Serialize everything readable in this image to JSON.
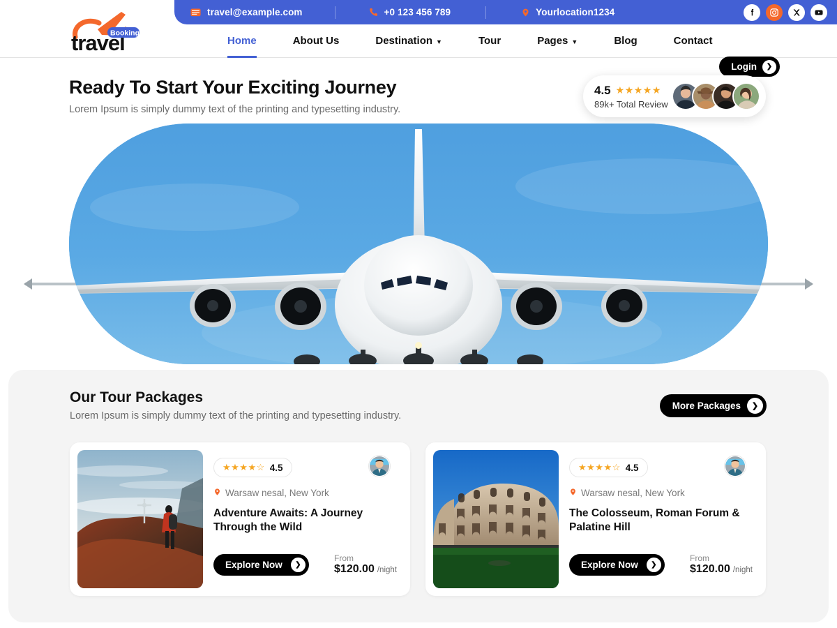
{
  "topbar": {
    "email": "travel@example.com",
    "phone": "+0 123 456 789",
    "location": "Yourlocation1234",
    "email_icon": "mail-icon",
    "phone_icon": "phone-icon",
    "location_icon": "map-pin-icon",
    "bg_color": "#4360d4",
    "socials": [
      {
        "name": "facebook",
        "glyph": "f"
      },
      {
        "name": "instagram",
        "glyph": "◎"
      },
      {
        "name": "twitter-x",
        "glyph": "✕"
      },
      {
        "name": "youtube",
        "glyph": "▶"
      }
    ]
  },
  "logo": {
    "word": "travel",
    "badge": "Booking",
    "accent": "#f4682c"
  },
  "nav": {
    "items": [
      {
        "label": "Home",
        "active": true,
        "caret": false
      },
      {
        "label": "About Us",
        "active": false,
        "caret": false
      },
      {
        "label": "Destination",
        "active": false,
        "caret": true
      },
      {
        "label": "Tour",
        "active": false,
        "caret": false
      },
      {
        "label": "Pages",
        "active": false,
        "caret": true
      },
      {
        "label": "Blog",
        "active": false,
        "caret": false
      },
      {
        "label": "Contact",
        "active": false,
        "caret": false
      }
    ],
    "login_label": "Login",
    "active_color": "#4360d4"
  },
  "hero": {
    "title": "Ready To Start Your Exciting Journey",
    "subtitle": "Lorem Ipsum is simply dummy text of the printing and typesetting industry.",
    "image_alt": "airplane-front-view-in-blue-sky"
  },
  "review_badge": {
    "score": "4.5",
    "stars": "★★★★★",
    "text": "89k+ Total Review",
    "star_color": "#f5a623",
    "avatar_count": 4
  },
  "packages": {
    "title": "Our Tour Packages",
    "subtitle": "Lorem Ipsum is simply dummy text of the printing and typesetting industry.",
    "more_label": "More Packages",
    "cards": [
      {
        "stars_filled": "★★★★",
        "stars_empty": "☆",
        "rating": "4.5",
        "location": "Warsaw nesal, New York",
        "title": "Adventure Awaits: A Journey Through the Wild",
        "cta": "Explore  Now",
        "price_from": "From",
        "price": "$120.00",
        "price_unit": "/night",
        "image_alt": "hiker-on-mountain-ridge-with-summit-cross"
      },
      {
        "stars_filled": "★★★★",
        "stars_empty": "☆",
        "rating": "4.5",
        "location": "Warsaw nesal, New York",
        "title": "The Colosseum, Roman Forum & Palatine Hill",
        "cta": "Explore  Now",
        "price_from": "From",
        "price": "$120.00",
        "price_unit": "/night",
        "image_alt": "colosseum-rome-with-blue-sky-and-green-lawn"
      }
    ]
  }
}
